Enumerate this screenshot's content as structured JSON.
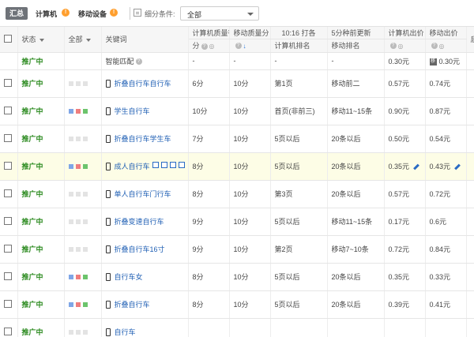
{
  "toolbar": {
    "all_label": "汇总",
    "pc_label": "计算机",
    "pc_badge": "!",
    "mobile_label": "移动设备",
    "mobile_badge": "!",
    "filter_label": "细分条件:",
    "filter_value": "全部"
  },
  "table": {
    "headers": {
      "status": "状态",
      "device": "全部",
      "keyword": "关键词",
      "pc_quality": "计算机质量得",
      "pc_quality_suffix": "分",
      "mobile_quality": "移动质量分",
      "rank_title": "10:16 打各",
      "pc_rank": "计算机排名",
      "est_title": "5分种前更新",
      "mobile_rank": "移动排名",
      "pc_bid": "计算机出价",
      "mobile_bid": "移动出价",
      "last": "后"
    },
    "summary": {
      "status": "推广中",
      "keyword": "智能匹配",
      "pc_quality": "-",
      "mobile_quality": "-",
      "pc_rank": "-",
      "mobile_rank": "-",
      "pc_bid": "0.30元",
      "mobile_bid": "0.30元"
    },
    "rows": [
      {
        "status": "推广中",
        "keyword": "折叠自行车自行车",
        "pc_quality": "6分",
        "mobile_quality": "10分",
        "pc_rank": "第1页",
        "mobile_rank": "移动前二",
        "pc_bid": "0.57元",
        "mobile_bid": "0.74元",
        "sq": [
          "g",
          "g",
          "g"
        ]
      },
      {
        "status": "推广中",
        "keyword": "学生自行车",
        "pc_quality": "10分",
        "mobile_quality": "10分",
        "pc_rank": "首页(非前三)",
        "mobile_rank": "移动11~15条",
        "pc_bid": "0.90元",
        "mobile_bid": "0.87元",
        "sq": [
          "b",
          "r",
          "gr"
        ]
      },
      {
        "status": "推广中",
        "keyword": "折叠自行车学生车",
        "pc_quality": "7分",
        "mobile_quality": "10分",
        "pc_rank": "5页以后",
        "mobile_rank": "20条以后",
        "pc_bid": "0.50元",
        "mobile_bid": "0.54元",
        "sq": [
          "g",
          "g",
          "g"
        ]
      },
      {
        "status": "推广中",
        "keyword": "成人自行车",
        "pc_quality": "8分",
        "mobile_quality": "10分",
        "pc_rank": "5页以后",
        "mobile_rank": "20条以后",
        "pc_bid": "0.35元",
        "mobile_bid": "0.43元",
        "sq": [
          "b",
          "r",
          "gr"
        ],
        "hl": true
      },
      {
        "status": "推广中",
        "keyword": "单人自行车门行车",
        "pc_quality": "8分",
        "mobile_quality": "10分",
        "pc_rank": "第3页",
        "mobile_rank": "20条以后",
        "pc_bid": "0.57元",
        "mobile_bid": "0.72元",
        "sq": [
          "g",
          "g",
          "g"
        ]
      },
      {
        "status": "推广中",
        "keyword": "折叠变速自行车",
        "pc_quality": "9分",
        "mobile_quality": "10分",
        "pc_rank": "5页以后",
        "mobile_rank": "移动11~15条",
        "pc_bid": "0.17元",
        "mobile_bid": "0.6元",
        "sq": [
          "g",
          "g",
          "g"
        ]
      },
      {
        "status": "推广中",
        "keyword": "折叠自行车16寸",
        "pc_quality": "9分",
        "mobile_quality": "10分",
        "pc_rank": "第2页",
        "mobile_rank": "移动7~10条",
        "pc_bid": "0.72元",
        "mobile_bid": "0.84元",
        "sq": [
          "g",
          "g",
          "g"
        ]
      },
      {
        "status": "推广中",
        "keyword": "自行车女",
        "pc_quality": "8分",
        "mobile_quality": "10分",
        "pc_rank": "5页以后",
        "mobile_rank": "20条以后",
        "pc_bid": "0.35元",
        "mobile_bid": "0.33元",
        "sq": [
          "b",
          "r",
          "gr"
        ]
      },
      {
        "status": "推广中",
        "keyword": "折叠自行车",
        "pc_quality": "8分",
        "mobile_quality": "10分",
        "pc_rank": "5页以后",
        "mobile_rank": "20条以后",
        "pc_bid": "0.39元",
        "mobile_bid": "0.41元",
        "sq": [
          "b",
          "r",
          "gr"
        ]
      },
      {
        "status": "推广中",
        "keyword": "自行车",
        "pc_quality": "",
        "mobile_quality": "",
        "pc_rank": "",
        "mobile_rank": "",
        "pc_bid": "",
        "mobile_bid": "",
        "sq": [
          "g",
          "g",
          "g"
        ]
      }
    ]
  }
}
